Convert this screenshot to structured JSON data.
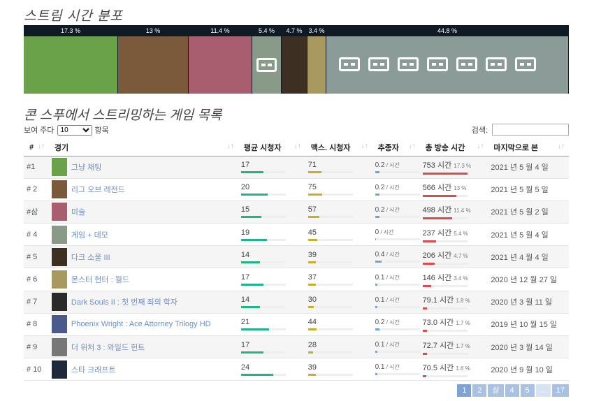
{
  "heading_dist": "스트림 시간 분포",
  "distribution": [
    {
      "pct": "17.3 %",
      "color": "#6aa24a",
      "share": 17.3
    },
    {
      "pct": "13 %",
      "color": "#7b5a3b",
      "share": 13
    },
    {
      "pct": "11.4 %",
      "color": "#a85e6e",
      "share": 11.4
    },
    {
      "pct": "5.4 %",
      "color": "#8a9a88",
      "share": 5.4
    },
    {
      "pct": "4.7 %",
      "color": "#3d3022",
      "share": 4.7
    },
    {
      "pct": "3.4 %",
      "color": "#a89a5e",
      "share": 3.4
    },
    {
      "pct": "44.8 %",
      "color": "#8a9b98",
      "share": 44.8
    }
  ],
  "heading_list": "콘 스푸에서 스트리밍하는 게임 목록",
  "length": {
    "prefix": "보여 주다",
    "value": "10",
    "suffix": "항목"
  },
  "search_label": "검색:",
  "columns": [
    "#",
    "경기",
    "평균 시청자",
    "맥스. 시청자",
    "추종자",
    "총 방송 시간",
    "마지막으로 본"
  ],
  "rows": [
    {
      "rank": "#1",
      "name": "그냥 채팅",
      "avg": "17",
      "avg_pct": 0.5,
      "max": "71",
      "max_pct": 0.3,
      "fol": "0.2",
      "fol_pct": 0.1,
      "tot": "753 시간",
      "totp": "17.3 %",
      "tot_pct": 1.0,
      "date": "2021 년 5 월 4 일",
      "tc": "#6aa24a"
    },
    {
      "rank": "# 2",
      "name": "리그 오브 레전드",
      "avg": "20",
      "avg_pct": 0.6,
      "max": "75",
      "max_pct": 0.32,
      "fol": "0.2",
      "fol_pct": 0.1,
      "tot": "566 시간",
      "totp": "13 %",
      "tot_pct": 0.75,
      "date": "2021 년 5 월 5 일",
      "tc": "#7b5a3b"
    },
    {
      "rank": "#삼",
      "name": "미술",
      "avg": "15",
      "avg_pct": 0.45,
      "max": "57",
      "max_pct": 0.25,
      "fol": "0.2",
      "fol_pct": 0.1,
      "tot": "498 시간",
      "totp": "11.4 %",
      "tot_pct": 0.66,
      "date": "2021 년 5 월 2 일",
      "tc": "#a85e6e"
    },
    {
      "rank": "# 4",
      "name": "게임 + 데모",
      "avg": "19",
      "avg_pct": 0.58,
      "max": "45",
      "max_pct": 0.2,
      "fol": "0",
      "fol_pct": 0.02,
      "tot": "237 시간",
      "totp": "5.4 %",
      "tot_pct": 0.31,
      "date": "2021 년 5 월 4 일",
      "tc": "#8a9a88"
    },
    {
      "rank": "# 5",
      "name": "다크 소울 III",
      "avg": "14",
      "avg_pct": 0.42,
      "max": "39",
      "max_pct": 0.18,
      "fol": "0.4",
      "fol_pct": 0.15,
      "tot": "206 시간",
      "totp": "4.7 %",
      "tot_pct": 0.27,
      "date": "2021 년 4 월 4 일",
      "tc": "#3d3022"
    },
    {
      "rank": "# 6",
      "name": "몬스터 헌터 : 월드",
      "avg": "17",
      "avg_pct": 0.5,
      "max": "37",
      "max_pct": 0.17,
      "fol": "0.1",
      "fol_pct": 0.05,
      "tot": "146 시간",
      "totp": "3.4 %",
      "tot_pct": 0.19,
      "date": "2020 년 12 월 27 일",
      "tc": "#a89a5e"
    },
    {
      "rank": "# 7",
      "name": "Dark Souls II : 첫 번째 죄의 학자",
      "avg": "14",
      "avg_pct": 0.42,
      "max": "30",
      "max_pct": 0.13,
      "fol": "0.1",
      "fol_pct": 0.05,
      "tot": "79.1 시간",
      "totp": "1.8 %",
      "tot_pct": 0.1,
      "date": "2020 년 3 월 11 일",
      "tc": "#2a2a2a"
    },
    {
      "rank": "# 8",
      "name": "Phoenix Wright : Ace Attorney Trilogy HD",
      "avg": "21",
      "avg_pct": 0.63,
      "max": "44",
      "max_pct": 0.19,
      "fol": "0.2",
      "fol_pct": 0.1,
      "tot": "73.0 시간",
      "totp": "1.7 %",
      "tot_pct": 0.1,
      "date": "2019 년 10 월 15 일",
      "tc": "#4a5a8a"
    },
    {
      "rank": "# 9",
      "name": "더 위처 3 : 와일드 헌트",
      "avg": "17",
      "avg_pct": 0.5,
      "max": "28",
      "max_pct": 0.12,
      "fol": "0.1",
      "fol_pct": 0.05,
      "tot": "72.7 시간",
      "totp": "1.7 %",
      "tot_pct": 0.1,
      "date": "2020 년 3 월 14 일",
      "tc": "#777"
    },
    {
      "rank": "# 10",
      "name": "스타 크래프트",
      "avg": "24",
      "avg_pct": 0.72,
      "max": "39",
      "max_pct": 0.18,
      "fol": "0.1",
      "fol_pct": 0.05,
      "tot": "70.5 시간",
      "totp": "1.6 %",
      "tot_pct": 0.09,
      "date": "2020 년 9 월 10 일",
      "tc": "#1e2a3a"
    }
  ],
  "pager": [
    "1",
    "2",
    "삼",
    "4",
    "5",
    "...",
    "17"
  ],
  "colors": {
    "avg": "#21b38a",
    "max": "#c4b02a",
    "fol": "#6aa6d8",
    "tot": "#e04a4a"
  }
}
